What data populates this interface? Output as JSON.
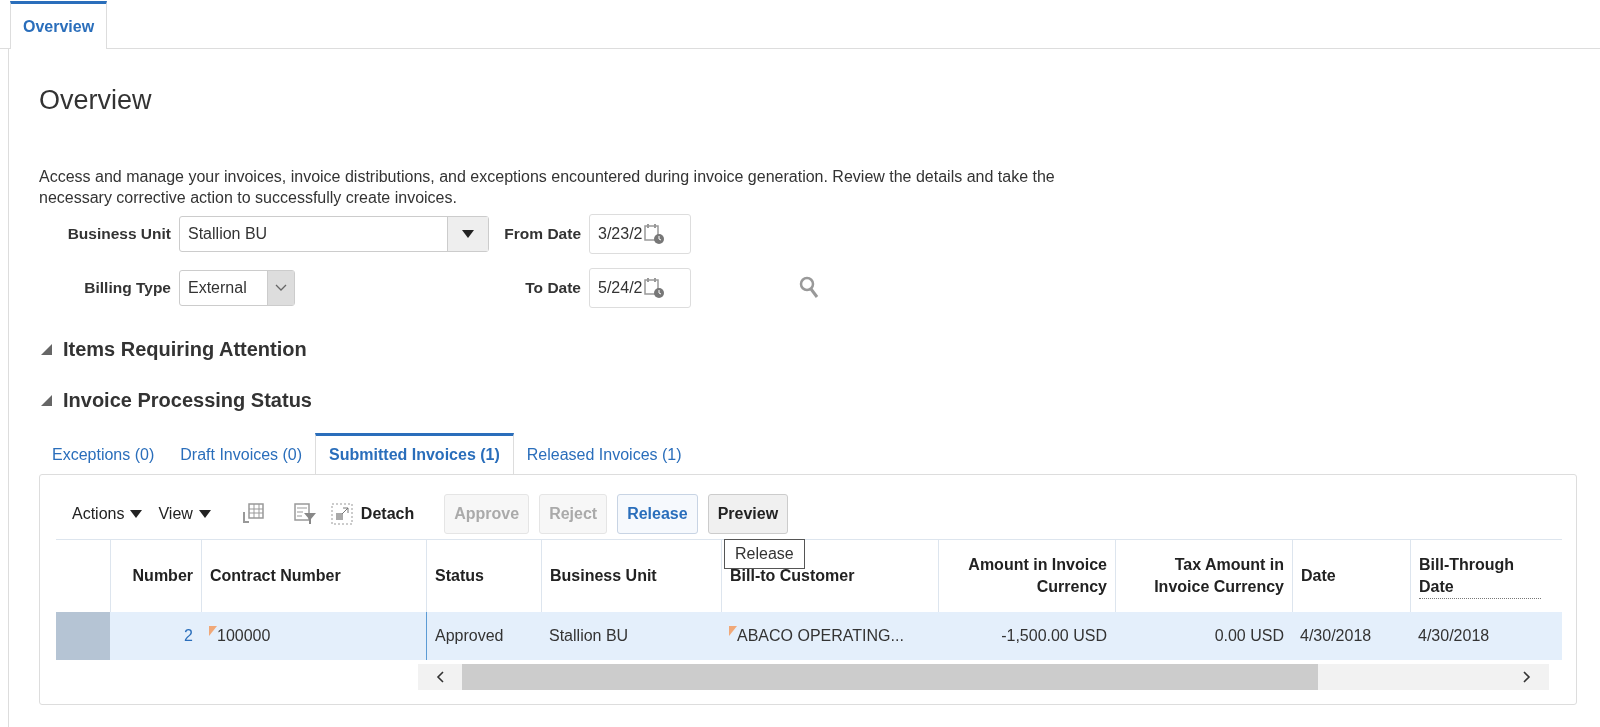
{
  "page_tabs": [
    {
      "label": "Overview",
      "selected": true
    }
  ],
  "title": "Overview",
  "description": "Access and manage your invoices, invoice distributions, and exceptions encountered during invoice generation. Review the details and take the necessary corrective action to successfully create invoices.",
  "filters": {
    "business_unit": {
      "label": "Business Unit",
      "value": "Stallion BU"
    },
    "billing_type": {
      "label": "Billing Type",
      "value": "External"
    },
    "from_date": {
      "label": "From Date",
      "value": "3/23/2"
    },
    "to_date": {
      "label": "To Date",
      "value": "5/24/2"
    }
  },
  "sections": [
    {
      "title": "Items Requiring Attention",
      "expanded": true
    },
    {
      "title": "Invoice Processing Status",
      "expanded": true
    }
  ],
  "status_tabs": [
    {
      "label": "Exceptions (0)",
      "selected": false
    },
    {
      "label": "Draft Invoices (0)",
      "selected": false
    },
    {
      "label": "Submitted Invoices (1)",
      "selected": true
    },
    {
      "label": "Released Invoices (1)",
      "selected": false
    }
  ],
  "toolbar": {
    "menus": [
      "Actions",
      "View"
    ],
    "detach": "Detach",
    "buttons": [
      {
        "label": "Approve",
        "disabled": true,
        "hovered": false
      },
      {
        "label": "Reject",
        "disabled": true,
        "hovered": false
      },
      {
        "label": "Release",
        "disabled": false,
        "hovered": true
      },
      {
        "label": "Preview",
        "disabled": false,
        "hovered": false
      }
    ]
  },
  "tooltip": "Release",
  "table": {
    "columns": [
      "Number",
      "Contract Number",
      "Status",
      "Business Unit",
      "Bill-to Customer",
      "Amount in Invoice Currency",
      "Tax Amount in Invoice Currency",
      "Date",
      "Bill-Through Date"
    ],
    "rows": [
      {
        "selected": true,
        "cells": [
          {
            "text": "2",
            "link": true,
            "flagged": false
          },
          {
            "text": "100000",
            "link": false,
            "flagged": true
          },
          {
            "text": "Approved",
            "link": false,
            "flagged": false
          },
          {
            "text": "Stallion BU",
            "link": false,
            "flagged": false
          },
          {
            "text": "ABACO OPERATING...",
            "link": false,
            "flagged": true
          },
          {
            "text": "-1,500.00 USD",
            "link": false,
            "flagged": false
          },
          {
            "text": "0.00 USD",
            "link": false,
            "flagged": false
          },
          {
            "text": "4/30/2018",
            "link": false,
            "flagged": false
          },
          {
            "text": "4/30/2018",
            "link": false,
            "flagged": false
          }
        ]
      }
    ]
  }
}
